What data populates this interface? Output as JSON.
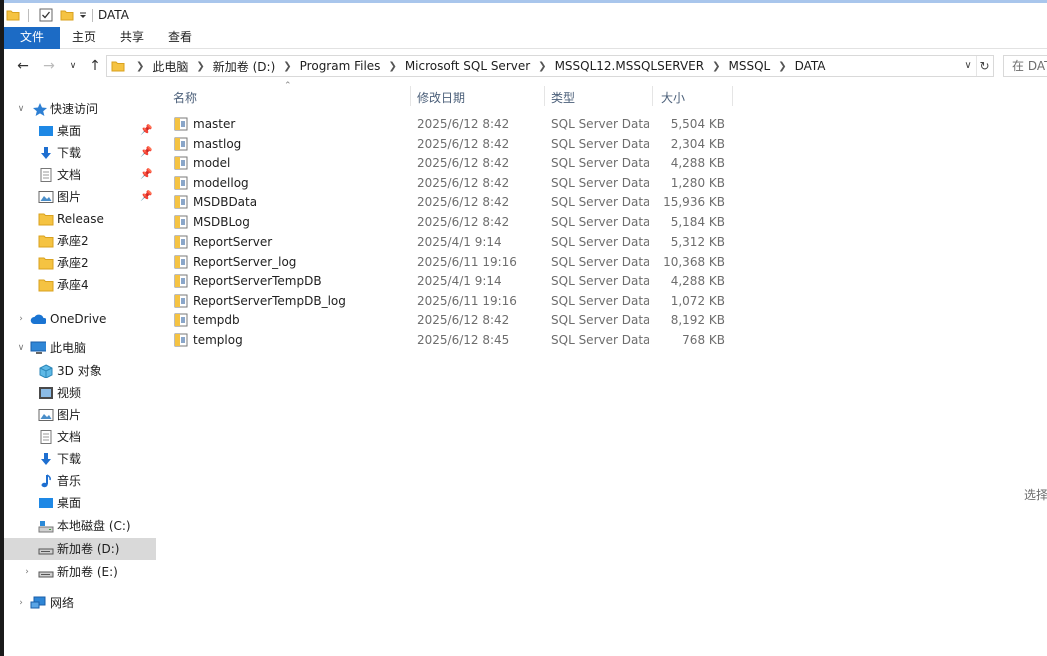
{
  "window": {
    "title": "DATA"
  },
  "ribbon": {
    "tabs": [
      "文件",
      "主页",
      "共享",
      "查看"
    ]
  },
  "address": {
    "crumbs": [
      "此电脑",
      "新加卷 (D:)",
      "Program Files",
      "Microsoft SQL Server",
      "MSSQL12.MSSQLSERVER",
      "MSSQL",
      "DATA"
    ]
  },
  "search": {
    "placeholder": "在 DATA"
  },
  "sidebar": {
    "quick_access": "快速访问",
    "quick_items": [
      "桌面",
      "下载",
      "文档",
      "图片",
      "Release",
      "承座2",
      "承座2",
      "承座4"
    ],
    "onedrive": "OneDrive",
    "this_pc": "此电脑",
    "pc_items": [
      "3D 对象",
      "视频",
      "图片",
      "文档",
      "下载",
      "音乐",
      "桌面",
      "本地磁盘 (C:)",
      "新加卷 (D:)",
      "新加卷 (E:)"
    ],
    "network": "网络"
  },
  "columns": {
    "name": "名称",
    "date": "修改日期",
    "type": "类型",
    "size": "大小"
  },
  "files": [
    {
      "name": "master",
      "date": "2025/6/12 8:42",
      "type": "SQL Server Data...",
      "size": "5,504 KB"
    },
    {
      "name": "mastlog",
      "date": "2025/6/12 8:42",
      "type": "SQL Server Data...",
      "size": "2,304 KB"
    },
    {
      "name": "model",
      "date": "2025/6/12 8:42",
      "type": "SQL Server Data...",
      "size": "4,288 KB"
    },
    {
      "name": "modellog",
      "date": "2025/6/12 8:42",
      "type": "SQL Server Data...",
      "size": "1,280 KB"
    },
    {
      "name": "MSDBData",
      "date": "2025/6/12 8:42",
      "type": "SQL Server Data...",
      "size": "15,936 KB"
    },
    {
      "name": "MSDBLog",
      "date": "2025/6/12 8:42",
      "type": "SQL Server Data...",
      "size": "5,184 KB"
    },
    {
      "name": "ReportServer",
      "date": "2025/4/1 9:14",
      "type": "SQL Server Data...",
      "size": "5,312 KB"
    },
    {
      "name": "ReportServer_log",
      "date": "2025/6/11 19:16",
      "type": "SQL Server Data...",
      "size": "10,368 KB"
    },
    {
      "name": "ReportServerTempDB",
      "date": "2025/4/1 9:14",
      "type": "SQL Server Data...",
      "size": "4,288 KB"
    },
    {
      "name": "ReportServerTempDB_log",
      "date": "2025/6/11 19:16",
      "type": "SQL Server Data...",
      "size": "1,072 KB"
    },
    {
      "name": "tempdb",
      "date": "2025/6/12 8:42",
      "type": "SQL Server Data...",
      "size": "8,192 KB"
    },
    {
      "name": "templog",
      "date": "2025/6/12 8:45",
      "type": "SQL Server Data...",
      "size": "768 KB"
    }
  ],
  "preview_hint": "选择要",
  "colors": {
    "accent": "#1c6bc5",
    "folder": "#f5c342",
    "selected_row": "#d9d9d9"
  }
}
